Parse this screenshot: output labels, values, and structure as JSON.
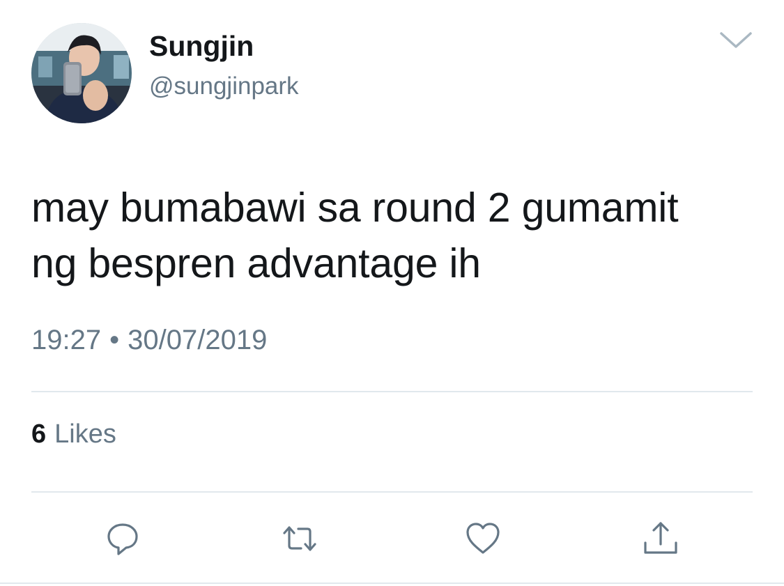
{
  "author": {
    "display_name": "Sungjin",
    "handle": "@sungjinpark"
  },
  "tweet": {
    "text_lines": [
      "may bumabawi sa round 2 gumamit",
      "ng bespren advantage ih"
    ],
    "time": "19:27",
    "separator": "•",
    "date": "30/07/2019"
  },
  "stats": {
    "likes_count": "6",
    "likes_label": "Likes"
  },
  "icons": {
    "menu": "chevron-down-icon",
    "reply": "reply-icon",
    "retweet": "retweet-icon",
    "like": "heart-icon",
    "share": "share-icon"
  },
  "colors": {
    "text_primary": "#14171a",
    "text_secondary": "#657786",
    "icon": "#657786",
    "divider": "#e1e8ed"
  }
}
